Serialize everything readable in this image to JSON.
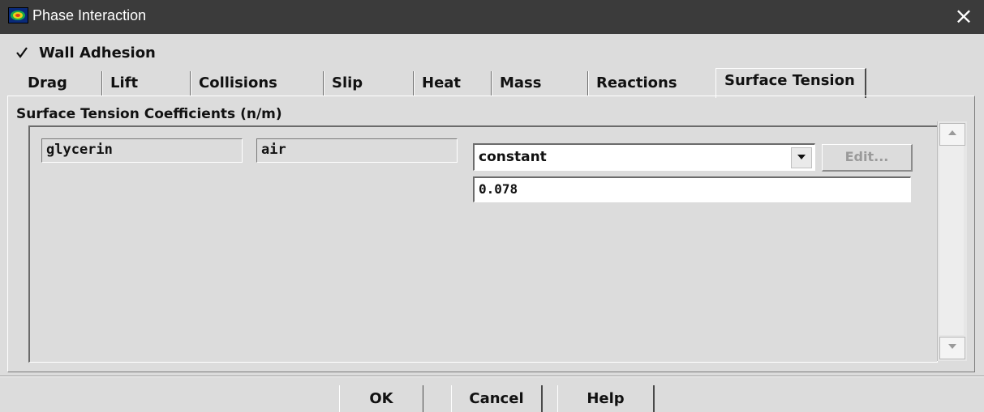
{
  "window": {
    "title": "Phase Interaction",
    "app_icon": "fluent-app-icon",
    "close_icon": "close-icon",
    "close_glyph": "×"
  },
  "wall_adhesion": {
    "label": "Wall Adhesion",
    "checked": true
  },
  "tabs": [
    {
      "label": "Drag",
      "active": false
    },
    {
      "label": "Lift",
      "active": false
    },
    {
      "label": "Collisions",
      "active": false
    },
    {
      "label": "Slip",
      "active": false
    },
    {
      "label": "Heat",
      "active": false
    },
    {
      "label": "Mass",
      "active": false
    },
    {
      "label": "Reactions",
      "active": false
    },
    {
      "label": "Surface Tension",
      "active": true
    }
  ],
  "surface_tension": {
    "group_title": "Surface Tension Coefficients (n/m)",
    "phase_1": "glycerin",
    "phase_2": "air",
    "method": {
      "selected": "constant"
    },
    "edit_label": "Edit...",
    "value": "0.078"
  },
  "footer": {
    "ok_label": "OK",
    "cancel_label": "Cancel",
    "help_label": "Help"
  },
  "colors": {
    "titlebar": "#3b3b3b",
    "background": "#dcdcdc",
    "disabled_text": "#9a9a9a"
  }
}
